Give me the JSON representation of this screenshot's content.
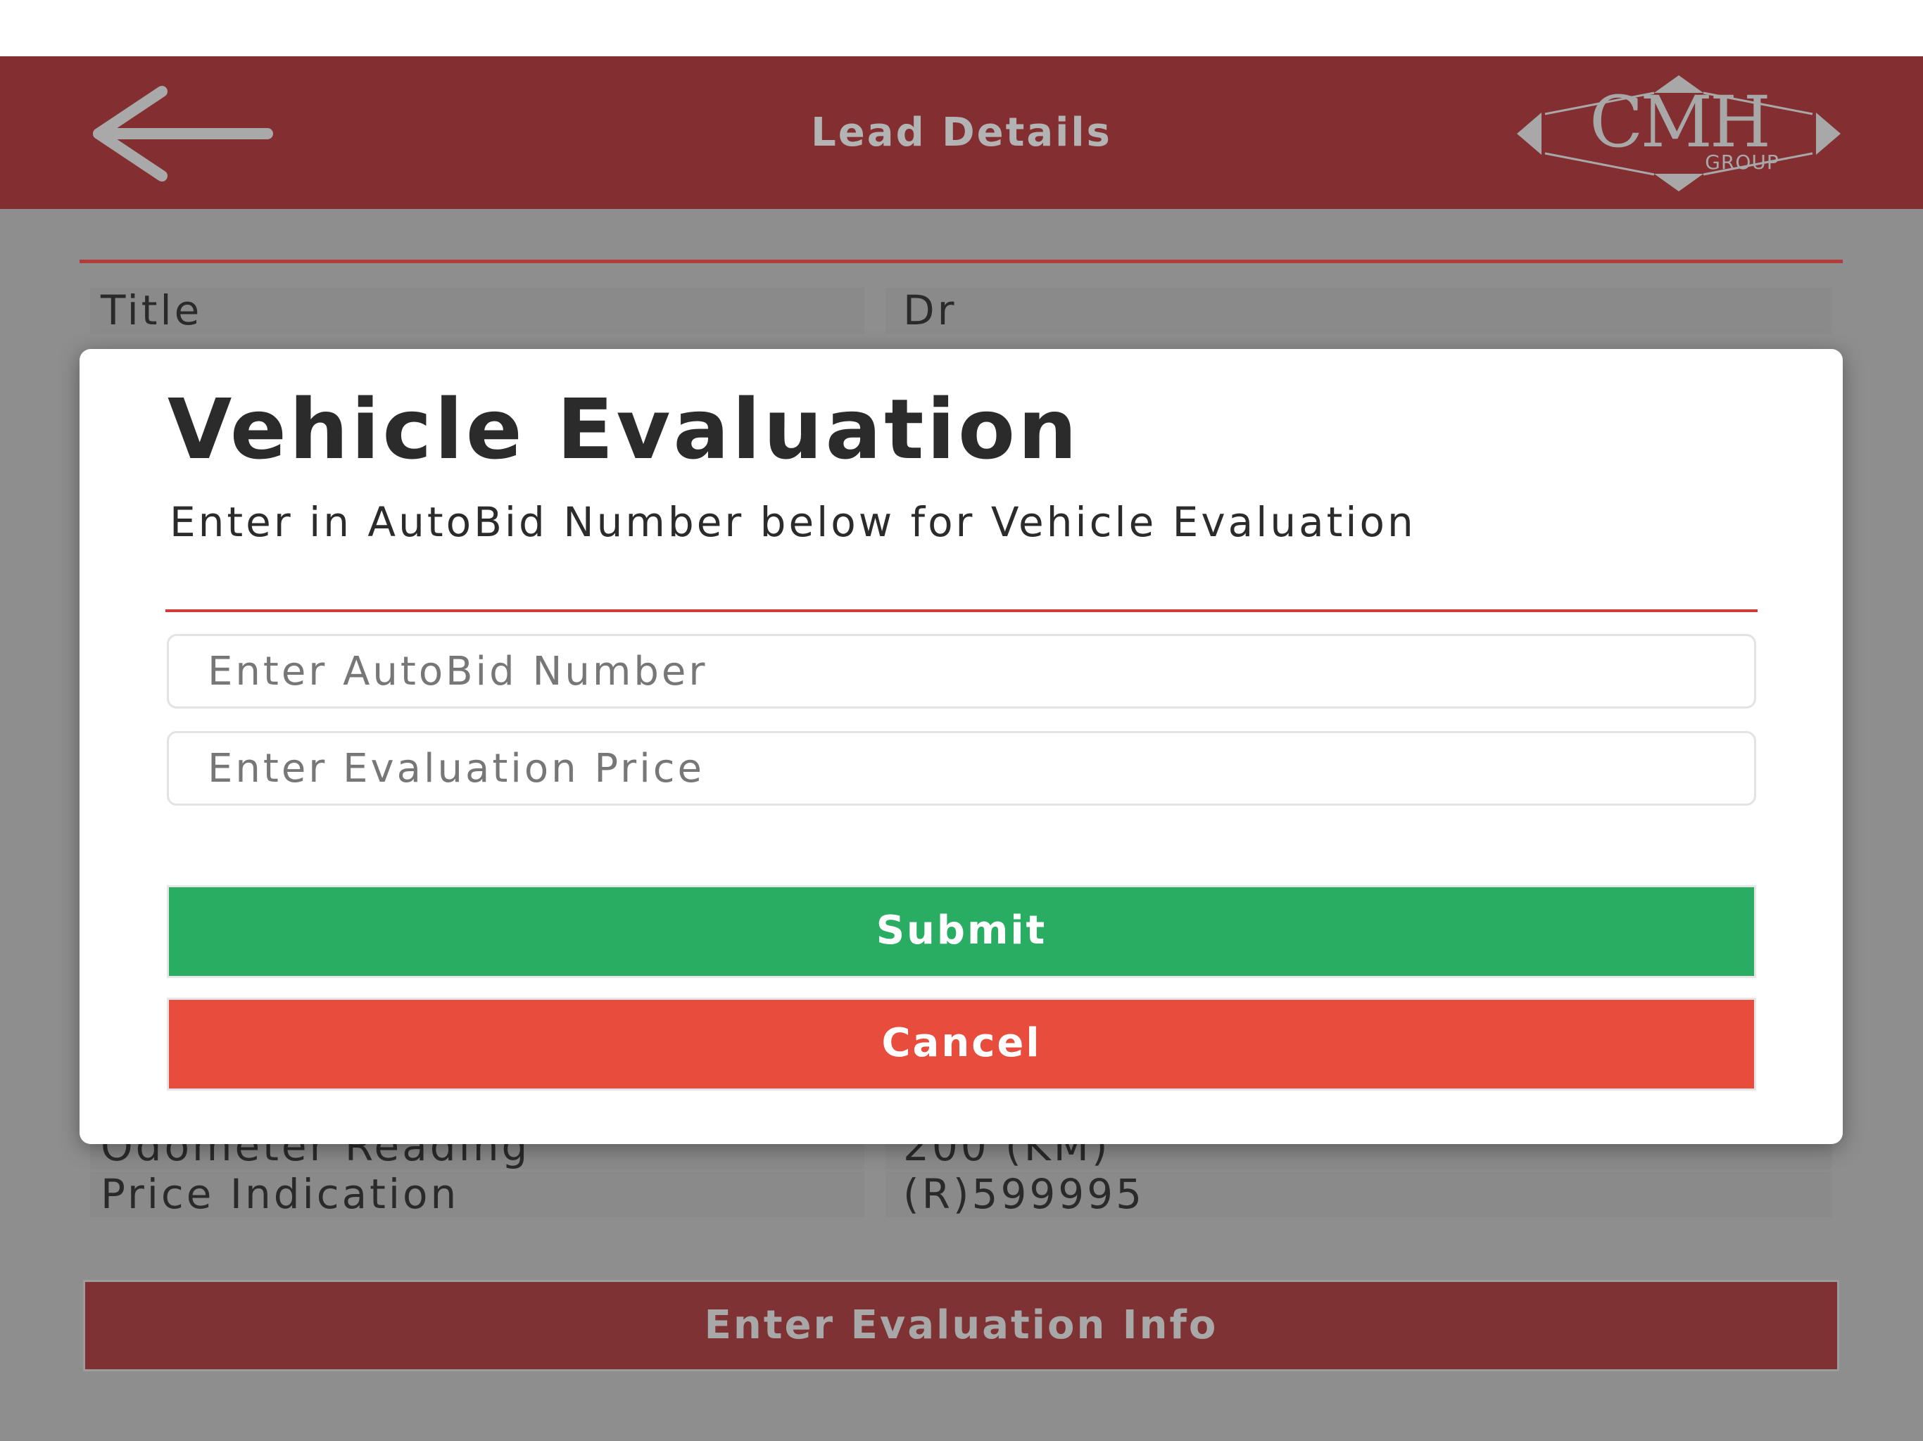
{
  "header": {
    "back_icon": "arrow-left-icon",
    "title": "Lead Details",
    "logo": {
      "text": "CMH",
      "subtext": "GROUP"
    }
  },
  "details": {
    "rows": [
      {
        "label": "Title",
        "value": "Dr"
      },
      {
        "label": "Odometer Reading",
        "value": "200 (KM)"
      },
      {
        "label": "Price Indication",
        "value": "(R)599995"
      }
    ],
    "action_label": "Enter Evaluation Info"
  },
  "modal": {
    "title": "Vehicle Evaluation",
    "message": "Enter in AutoBid Number below for Vehicle Evaluation",
    "autobid_placeholder": "Enter AutoBid Number",
    "autobid_value": "",
    "price_placeholder": "Enter Evaluation Price",
    "price_value": "",
    "submit_label": "Submit",
    "cancel_label": "Cancel"
  },
  "colors": {
    "header_bg": "#832f32",
    "overlay_bg": "#8e8e8e",
    "submit": "#28ad63",
    "cancel": "#e74c3c",
    "accent_rule": "#d23a3a"
  }
}
